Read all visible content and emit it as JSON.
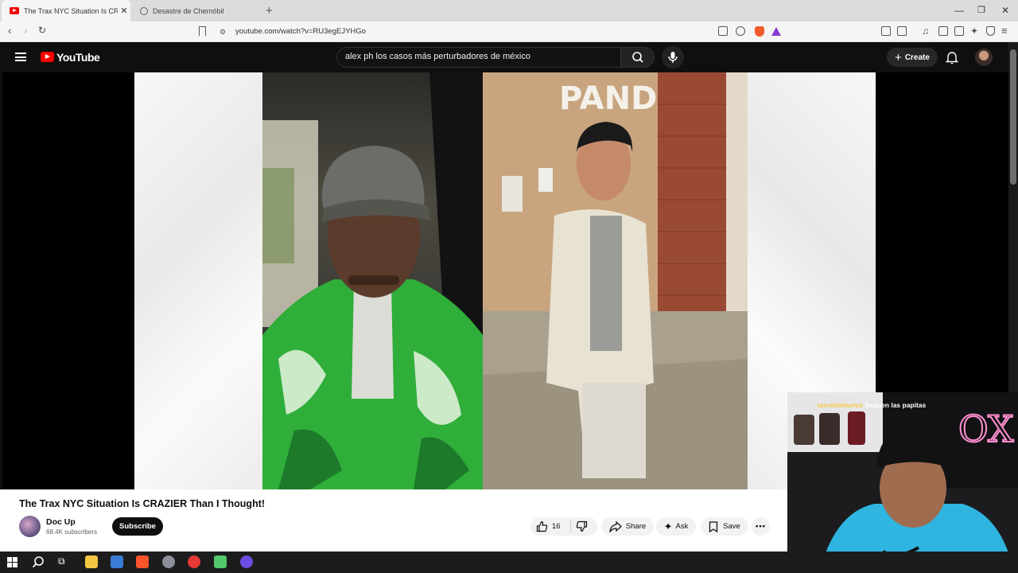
{
  "browser": {
    "tabs": [
      {
        "title": "The Trax NYC Situation Is CRAZIER",
        "active": true
      },
      {
        "title": "Desastre de Chernóbil",
        "active": false
      }
    ],
    "url": "youtube.com/watch?v=RU3egEJYHGo"
  },
  "youtube": {
    "logo_text": "YouTube",
    "search_query": "alex ph los casos más perturbadores de méxico",
    "create_label": "Create"
  },
  "video": {
    "title": "The Trax NYC Situation Is CRAZIER Than I Thought!",
    "channel": "Doc Up",
    "subscribers": "68.4K subscribers",
    "subscribe_label": "Subscribe",
    "likes": "16",
    "share_label": "Share",
    "ask_label": "Ask",
    "save_label": "Save",
    "storefront_sign": "PAND"
  },
  "overlay": {
    "chat_user": "_tamaldehuevo",
    "chat_message": "Saquen las papitas",
    "neon_sign": "OX"
  },
  "colors": {
    "yt_red": "#ff0000",
    "dark_bg": "#0f0f0f",
    "shirt_green": "#2fae3a",
    "chat_user": "#f7c948"
  },
  "icons": [
    "menu-icon",
    "youtube-logo-icon",
    "search-icon",
    "mic-icon",
    "plus-icon",
    "bell-icon",
    "like-icon",
    "dislike-icon",
    "share-icon",
    "sparkle-icon",
    "save-icon",
    "more-icon"
  ]
}
